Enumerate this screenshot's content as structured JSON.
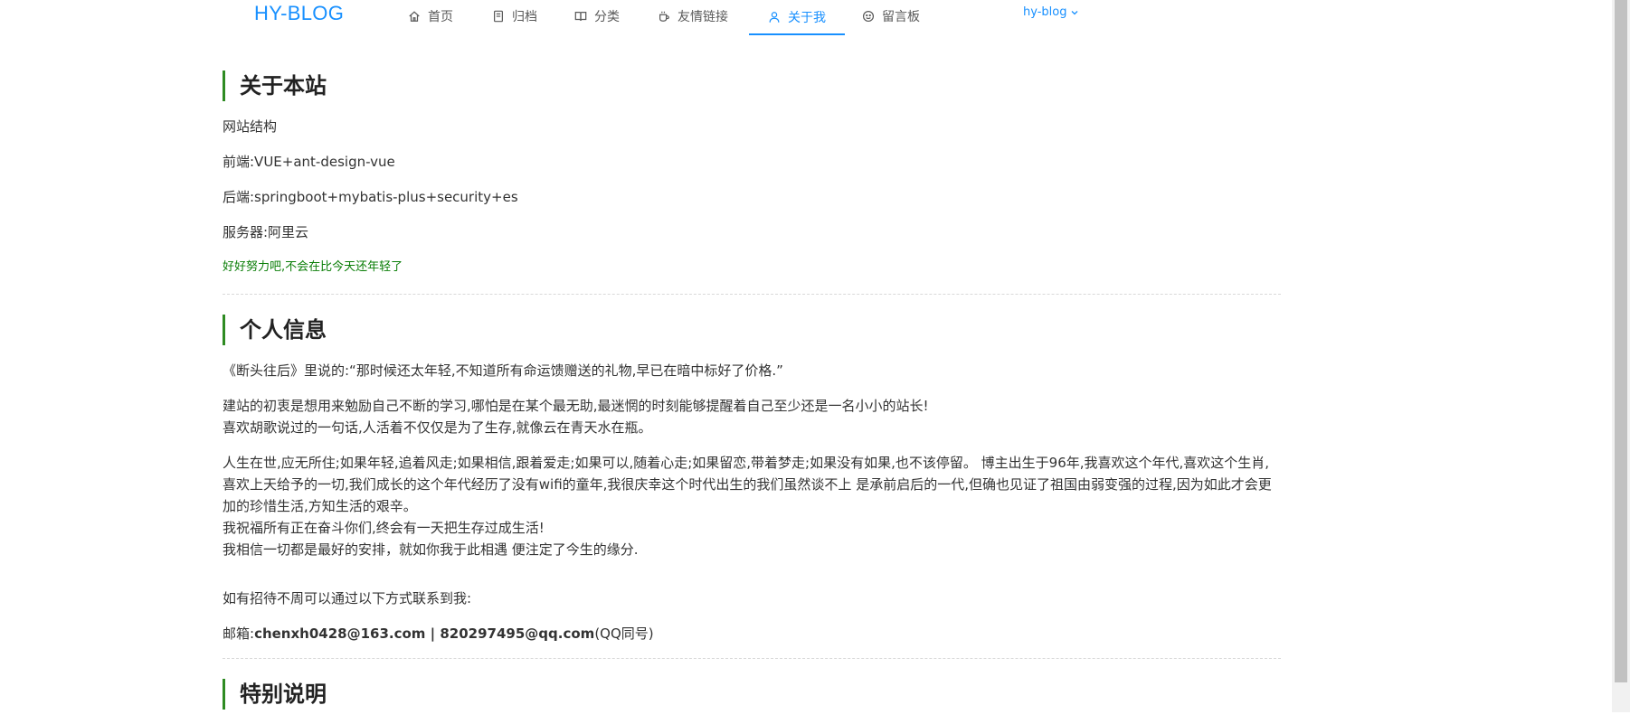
{
  "header": {
    "logo": "HY-BLOG",
    "nav": [
      {
        "label": "首页",
        "icon": "home-icon"
      },
      {
        "label": "归档",
        "icon": "book-icon"
      },
      {
        "label": "分类",
        "icon": "read-icon"
      },
      {
        "label": "友情链接",
        "icon": "coffee-icon"
      },
      {
        "label": "关于我",
        "icon": "user-icon",
        "active": true
      },
      {
        "label": "留言板",
        "icon": "smile-icon"
      }
    ],
    "user_menu": "hy-blog"
  },
  "colors": {
    "accent": "#1890ff",
    "section_bar": "#2e8b22",
    "motto": "#0a7e07"
  },
  "about_site": {
    "title": "关于本站",
    "structure": "网站结构",
    "frontend": "前端:VUE+ant-design-vue",
    "backend": "后端:springboot+mybatis-plus+security+es",
    "server": "服务器:阿里云",
    "motto": "好好努力吧,不会在比今天还年轻了"
  },
  "personal": {
    "title": "个人信息",
    "quote": "《断头往后》里说的:“那时候还太年轻,不知道所有命运馈赠送的礼物,早已在暗中标好了价格.”",
    "p2_line1": "建站的初衷是想用来勉励自己不断的学习,哪怕是在某个最无助,最迷惘的时刻能够提醒着自己至少还是一名小小的站长!",
    "p2_line2": "喜欢胡歌说过的一句话,人活着不仅仅是为了生存,就像云在青天水在瓶。",
    "p3": "人生在世,应无所住;如果年轻,追着风走;如果相信,跟着爱走;如果可以,随着心走;如果留恋,带着梦走;如果没有如果,也不该停留。 博主出生于96年,我喜欢这个年代,喜欢这个生肖,喜欢上天给予的一切,我们成长的这个年代经历了没有wifi的童年,我很庆幸这个时代出生的我们虽然谈不上 是承前启后的一代,但确也见证了祖国由弱变强的过程,因为如此才会更加的珍惜生活,方知生活的艰辛。",
    "p3_line2": "我祝福所有正在奋斗你们,终会有一天把生存过成生活!",
    "p3_line3": "我相信一切都是最好的安排，就如你我于此相遇 便注定了今生的缘分.",
    "contact_intro": "如有招待不周可以通过以下方式联系到我:",
    "contact_label": "邮箱:",
    "email1": "chenxh0428@163.com",
    "separator": " | ",
    "email2": "820297495@qq.com",
    "qq_note": "(QQ同号)"
  },
  "special": {
    "title": "特别说明"
  }
}
